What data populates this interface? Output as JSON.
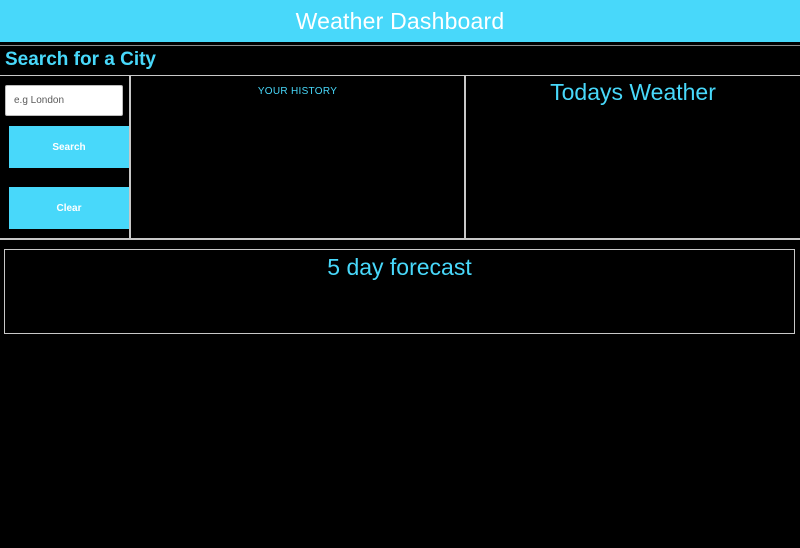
{
  "header": {
    "title": "Weather Dashboard"
  },
  "search": {
    "title": "Search for a City",
    "placeholder": "e.g London",
    "search_label": "Search",
    "clear_label": "Clear"
  },
  "history": {
    "title": "YOUR HISTORY"
  },
  "today": {
    "title": "Todays Weather"
  },
  "forecast": {
    "title": "5 day forecast"
  },
  "colors": {
    "accent": "#48d8fa",
    "background": "#000000",
    "border": "#c8c8c8"
  }
}
